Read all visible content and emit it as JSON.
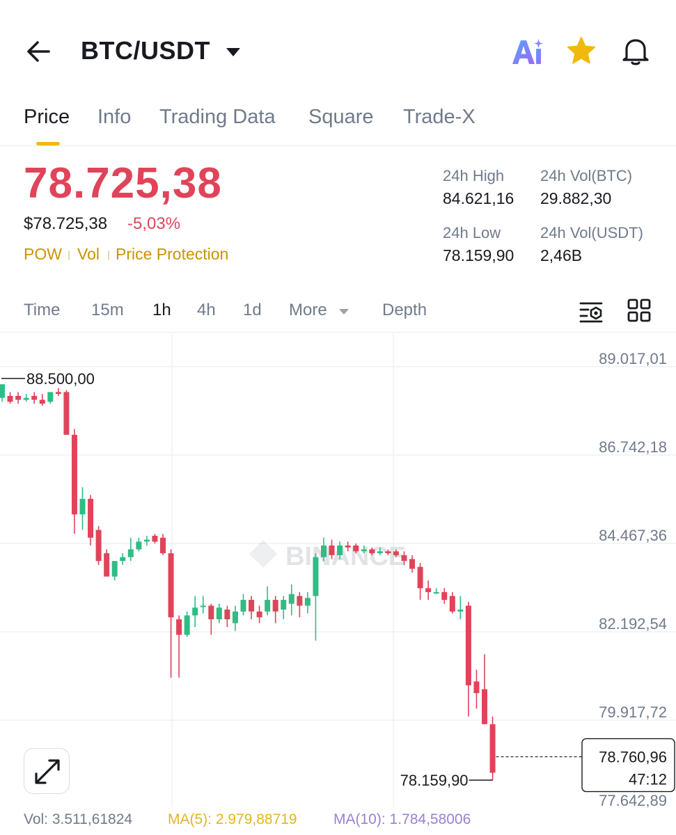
{
  "header": {
    "pair": "BTC/USDT",
    "icons": [
      "back-arrow-icon",
      "chevron-down-icon",
      "ai-icon",
      "star-icon",
      "bell-icon"
    ]
  },
  "tabs": [
    {
      "label": "Price",
      "active": true
    },
    {
      "label": "Info",
      "active": false
    },
    {
      "label": "Trading Data",
      "active": false
    },
    {
      "label": "Square",
      "active": false
    },
    {
      "label": "Trade-X",
      "active": false
    }
  ],
  "price": {
    "last": "78.725,38",
    "usd": "$78.725,38",
    "change": "-5,03%",
    "tags": [
      "POW",
      "Vol",
      "Price Protection"
    ]
  },
  "stats": {
    "high_label": "24h High",
    "high_value": "84.621,16",
    "vol_btc_label": "24h Vol(BTC)",
    "vol_btc_value": "29.882,30",
    "low_label": "24h Low",
    "low_value": "78.159,90",
    "vol_usdt_label": "24h Vol(USDT)",
    "vol_usdt_value": "2,46B"
  },
  "intervals": [
    {
      "label": "Time",
      "active": false
    },
    {
      "label": "15m",
      "active": false
    },
    {
      "label": "1h",
      "active": true
    },
    {
      "label": "4h",
      "active": false
    },
    {
      "label": "1d",
      "active": false
    },
    {
      "label": "More",
      "active": false
    },
    {
      "label": "Depth",
      "active": false
    }
  ],
  "colors": {
    "up": "#2ebd85",
    "down": "#e0445a",
    "accent": "#f0b90b",
    "ma5": "#e6b422",
    "ma10": "#9b7fd4"
  },
  "chart_data": {
    "type": "candlestick",
    "interval": "1h",
    "y_axis_labels": [
      "89.017,01",
      "86.742,18",
      "84.467,36",
      "82.192,54",
      "79.917,72",
      "77.642,89"
    ],
    "y_axis_values": [
      89017.01,
      86742.18,
      84467.36,
      82192.54,
      79917.72,
      77642.89
    ],
    "ylim": [
      77642.89,
      89017.01
    ],
    "high_marker": "88.500,00",
    "low_marker": "78.159,90",
    "current_price_tag": "78.760,96",
    "countdown": "47:12",
    "watermark": "BINANCE",
    "candles": [
      {
        "o": 88000,
        "h": 88100,
        "c": 88350,
        "l": 87900
      },
      {
        "o": 88050,
        "h": 88150,
        "c": 87900,
        "l": 87850
      },
      {
        "o": 88050,
        "h": 88150,
        "c": 87950,
        "l": 87850
      },
      {
        "o": 87950,
        "h": 88100,
        "c": 88000,
        "l": 87900
      },
      {
        "o": 88050,
        "h": 88150,
        "c": 87950,
        "l": 87850
      },
      {
        "o": 87950,
        "h": 88100,
        "c": 87850,
        "l": 87800
      },
      {
        "o": 87900,
        "h": 88100,
        "c": 88150,
        "l": 87850
      },
      {
        "o": 88150,
        "h": 88250,
        "c": 88100,
        "l": 88050
      },
      {
        "o": 88150,
        "h": 88200,
        "c": 87050,
        "l": 87050
      },
      {
        "o": 87050,
        "h": 87200,
        "c": 85000,
        "l": 84500
      },
      {
        "o": 85000,
        "h": 85700,
        "c": 85400,
        "l": 84600
      },
      {
        "o": 85400,
        "h": 85500,
        "c": 84400,
        "l": 84200
      },
      {
        "o": 84600,
        "h": 84700,
        "c": 83800,
        "l": 83700
      },
      {
        "o": 84000,
        "h": 84100,
        "c": 83400,
        "l": 83400
      },
      {
        "o": 83400,
        "h": 83800,
        "c": 83800,
        "l": 83300
      },
      {
        "o": 83800,
        "h": 84000,
        "c": 83900,
        "l": 83700
      },
      {
        "o": 83900,
        "h": 84400,
        "c": 84100,
        "l": 83800
      },
      {
        "o": 84100,
        "h": 84400,
        "c": 84300,
        "l": 84050
      },
      {
        "o": 84300,
        "h": 84450,
        "c": 84350,
        "l": 84200
      },
      {
        "o": 84450,
        "h": 84500,
        "c": 84300,
        "l": 84250
      },
      {
        "o": 84400,
        "h": 84500,
        "c": 84000,
        "l": 83950
      },
      {
        "o": 84000,
        "h": 84100,
        "c": 82350,
        "l": 80800
      },
      {
        "o": 82300,
        "h": 82400,
        "c": 81900,
        "l": 80800
      },
      {
        "o": 81900,
        "h": 82500,
        "c": 82400,
        "l": 81850
      },
      {
        "o": 82400,
        "h": 82900,
        "c": 82600,
        "l": 82100
      },
      {
        "o": 82650,
        "h": 82900,
        "c": 82650,
        "l": 82450
      },
      {
        "o": 82650,
        "h": 82700,
        "c": 82300,
        "l": 81900
      },
      {
        "o": 82300,
        "h": 82700,
        "c": 82600,
        "l": 82200
      },
      {
        "o": 82550,
        "h": 82650,
        "c": 82300,
        "l": 82100
      },
      {
        "o": 82200,
        "h": 82650,
        "c": 82500,
        "l": 82000
      },
      {
        "o": 82500,
        "h": 82950,
        "c": 82800,
        "l": 82400
      },
      {
        "o": 82800,
        "h": 82900,
        "c": 82500,
        "l": 82300
      },
      {
        "o": 82500,
        "h": 82650,
        "c": 82350,
        "l": 82200
      },
      {
        "o": 82500,
        "h": 83150,
        "c": 82800,
        "l": 82400
      },
      {
        "o": 82800,
        "h": 82900,
        "c": 82500,
        "l": 82200
      },
      {
        "o": 82550,
        "h": 82900,
        "c": 82800,
        "l": 82300
      },
      {
        "o": 82700,
        "h": 83200,
        "c": 82950,
        "l": 82400
      },
      {
        "o": 82900,
        "h": 83000,
        "c": 82650,
        "l": 82350
      },
      {
        "o": 82650,
        "h": 83000,
        "c": 82850,
        "l": 82450
      },
      {
        "o": 82900,
        "h": 84000,
        "c": 83900,
        "l": 81750
      },
      {
        "o": 83900,
        "h": 84400,
        "c": 84200,
        "l": 83800
      },
      {
        "o": 84200,
        "h": 84350,
        "c": 83950,
        "l": 83850
      },
      {
        "o": 83950,
        "h": 84300,
        "c": 84200,
        "l": 83850
      },
      {
        "o": 84200,
        "h": 84300,
        "c": 84150,
        "l": 84050
      },
      {
        "o": 84200,
        "h": 84250,
        "c": 84050,
        "l": 84000
      },
      {
        "o": 84050,
        "h": 84200,
        "c": 84100,
        "l": 84000
      },
      {
        "o": 84100,
        "h": 84150,
        "c": 84000,
        "l": 83950
      },
      {
        "o": 84000,
        "h": 84150,
        "c": 84050,
        "l": 83950
      },
      {
        "o": 84050,
        "h": 84100,
        "c": 84000,
        "l": 83950
      },
      {
        "o": 84050,
        "h": 84100,
        "c": 83950,
        "l": 83900
      },
      {
        "o": 83950,
        "h": 84050,
        "c": 83800,
        "l": 83700
      },
      {
        "o": 83850,
        "h": 83950,
        "c": 83600,
        "l": 83500
      },
      {
        "o": 83650,
        "h": 83750,
        "c": 83100,
        "l": 82800
      },
      {
        "o": 83100,
        "h": 83300,
        "c": 83000,
        "l": 82800
      },
      {
        "o": 83000,
        "h": 83100,
        "c": 83000,
        "l": 82950
      },
      {
        "o": 83000,
        "h": 83100,
        "c": 82800,
        "l": 82700
      },
      {
        "o": 82900,
        "h": 83000,
        "c": 82500,
        "l": 82450
      },
      {
        "o": 82500,
        "h": 82900,
        "c": 82550,
        "l": 82300
      },
      {
        "o": 82650,
        "h": 82750,
        "c": 80600,
        "l": 79800
      },
      {
        "o": 80700,
        "h": 81000,
        "c": 80400,
        "l": 80000
      },
      {
        "o": 80500,
        "h": 81400,
        "c": 79600,
        "l": 79600
      },
      {
        "o": 79600,
        "h": 79800,
        "c": 78350,
        "l": 78150
      }
    ]
  },
  "volume": {
    "vol_label": "Vol: 3.511,61824",
    "ma5_label": "MA(5): 2.979,88719",
    "ma10_label": "MA(10): 1.784,58006"
  }
}
